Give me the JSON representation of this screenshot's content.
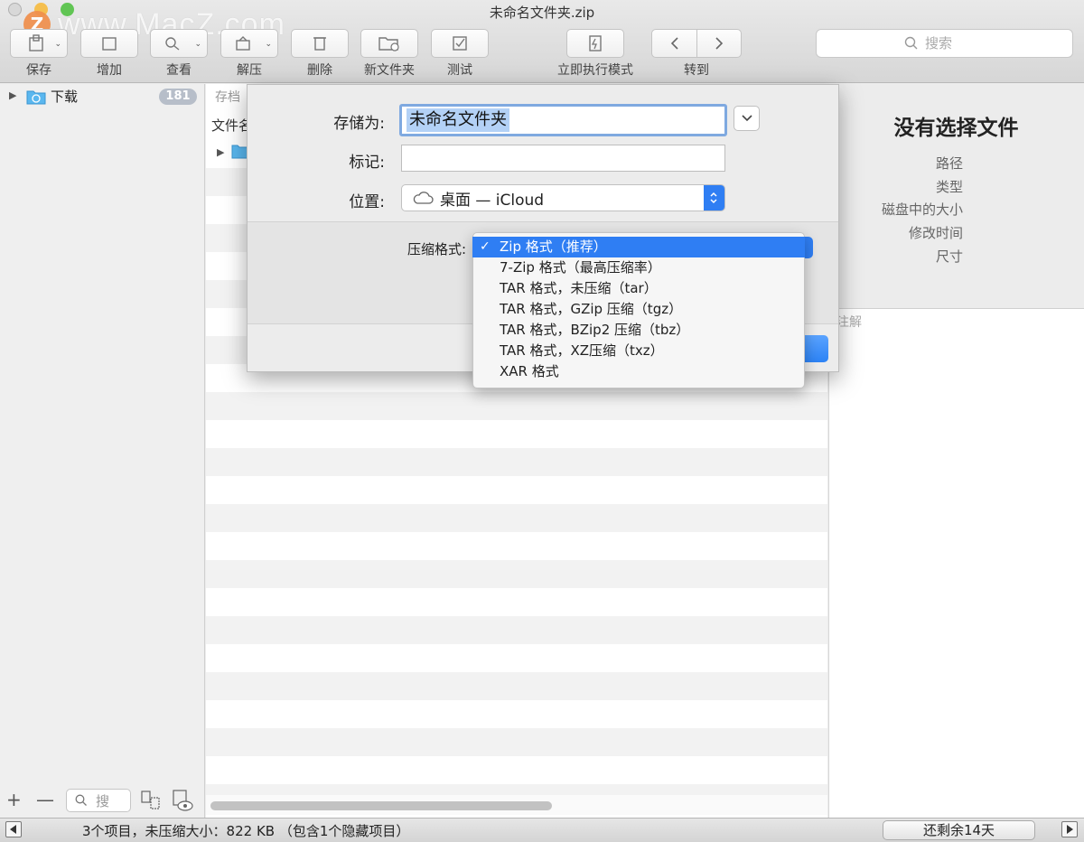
{
  "window": {
    "title": "未命名文件夹.zip",
    "watermark": "www.MacZ.com",
    "logo_letter": "Z"
  },
  "toolbar": {
    "buttons": [
      {
        "label": "保存",
        "icon": "save-icon"
      },
      {
        "label": "增加",
        "icon": "add-icon"
      },
      {
        "label": "查看",
        "icon": "view-icon"
      },
      {
        "label": "解压",
        "icon": "extract-icon"
      },
      {
        "label": "删除",
        "icon": "delete-icon"
      },
      {
        "label": "新文件夹",
        "icon": "new-folder-icon"
      },
      {
        "label": "测试",
        "icon": "test-icon"
      },
      {
        "label": "立即执行模式",
        "icon": "instant-mode-icon"
      },
      {
        "label": "转到",
        "icon": "go-icon"
      }
    ],
    "search_placeholder": "搜索"
  },
  "sidebar": {
    "items": [
      {
        "label": "下载",
        "badge": "181",
        "icon": "downloads-folder-icon"
      }
    ],
    "filter_placeholder": "搜"
  },
  "main": {
    "crumb": "存档",
    "column_header": "文件名"
  },
  "inspector": {
    "title": "没有选择文件",
    "fields": [
      "路径",
      "类型",
      "磁盘中的大小",
      "修改时间",
      "尺寸"
    ],
    "note_label": "注解"
  },
  "dialog": {
    "save_as_label": "存储为:",
    "save_as_value": "未命名文件夹",
    "tags_label": "标记:",
    "tags_value": "",
    "location_label": "位置:",
    "location_value": "桌面 — iCloud",
    "format_label": "压缩格式:"
  },
  "format_menu": {
    "selected_index": 0,
    "options": [
      "Zip 格式（推荐）",
      "7-Zip 格式（最高压缩率）",
      "TAR 格式，未压缩（tar）",
      "TAR 格式，GZip 压缩（tgz）",
      "TAR 格式，BZip2 压缩（tbz）",
      "TAR 格式，XZ压缩（txz）",
      "XAR 格式"
    ]
  },
  "statusbar": {
    "summary": "3个项目，未压缩大小：822 KB （包含1个隐藏项目）",
    "trial": "还剩余14天"
  },
  "colors": {
    "accent": "#2f7ef3",
    "badge": "#b7bec9",
    "selection": "#b3d1f6"
  }
}
